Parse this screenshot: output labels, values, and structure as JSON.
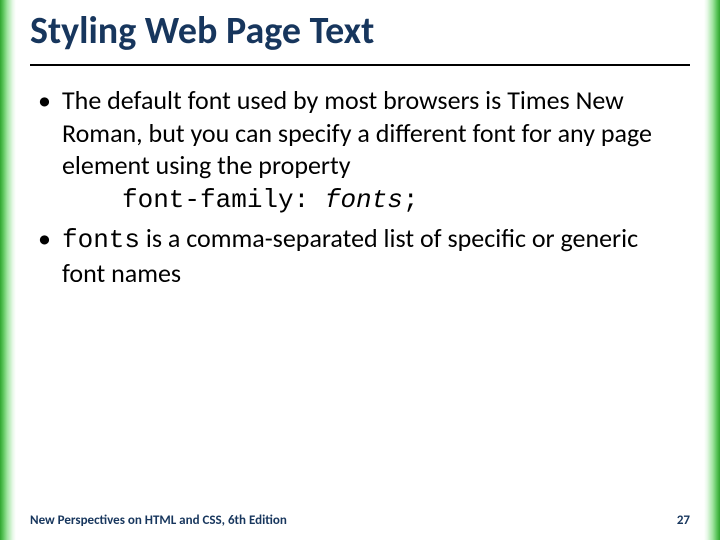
{
  "title": "Styling Web Page Text",
  "bullets": [
    {
      "text": "The default font used by most browsers is Times New Roman, but you can specify a different font for any page element using the property",
      "code_prop": "font-family:",
      "code_val": "fonts",
      "code_semi": ";"
    },
    {
      "mono_lead": "fonts",
      "rest": " is a comma-separated list of specific or generic font names"
    }
  ],
  "footer_left": "New Perspectives on HTML and CSS, 6th Edition",
  "footer_page": "27"
}
